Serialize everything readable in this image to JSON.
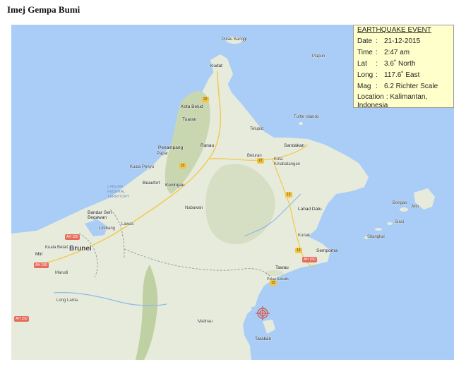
{
  "page": {
    "heading": "Imej Gempa Bumi"
  },
  "event": {
    "title": "EARTHQUAKE  EVENT",
    "rows": [
      {
        "key": "Date",
        "value": "21-12-2015"
      },
      {
        "key": "Time",
        "value": "2:47 am"
      },
      {
        "key": "Lat",
        "value": "3.6˚  North"
      },
      {
        "key": "Long",
        "value": "117.6˚  East"
      },
      {
        "key": "Mag",
        "value": "6.2 Richter Scale"
      }
    ],
    "location_key": "Location",
    "location_value": "Kalimantan, Indonesia",
    "separator": ":"
  },
  "map": {
    "labels": {
      "pulau_banggi": "Pulau Banggi",
      "kudat": "Kudat",
      "kota_belud": "Kota Belud",
      "tuaran": "Tuaran",
      "penampang": "Penampang",
      "papar": "Papar",
      "kuala_penyu": "Kuala Penyu",
      "beaufort": "Beaufort",
      "keningau": "Keningau",
      "ranau": "Ranau",
      "telupid": "Telupid",
      "beluran": "Beluran",
      "kota_kinabatangan": "Kota Kinabatangan",
      "sandakan": "Sandakan",
      "lahad_datu": "Lahad Datu",
      "kunak": "Kunak",
      "semporna": "Semporna",
      "tawau": "Tawau",
      "pulau_sebatik": "Pulau Sebatik",
      "nabawan": "Nabawan",
      "labuan": "LABUAN FEDERAL TERRITORY",
      "bandar_seri_begawan": "Bandar Seri Begawan",
      "brunei": "Brunei",
      "limbang": "Limbang",
      "lawas": "Lawas",
      "miri": "Miri",
      "kuala_belait": "Kuala Belait",
      "marudi": "Marudi",
      "long_lama": "Long Lama",
      "tarakan": "Tarakan",
      "malinau": "Malinau",
      "bongao": "Bongao",
      "jolo": "Jolo",
      "siasi": "Siasi",
      "sitangkai": "Sitangkai",
      "turtle_islands": "Turtle Islands",
      "mapun": "Mapun"
    },
    "shields": [
      "22",
      "22",
      "13",
      "13",
      "22",
      "AH 150",
      "AH 150",
      "13",
      "AH 150",
      "AH 150"
    ],
    "colors": {
      "sea": "#a9cdf6",
      "land": "#e7ebdc",
      "forest": "#c9d7b0",
      "info_bg": "#ffffcc",
      "marker": "#d84b3a"
    },
    "epicenter_marker": "epicenter-crosshair-icon"
  }
}
